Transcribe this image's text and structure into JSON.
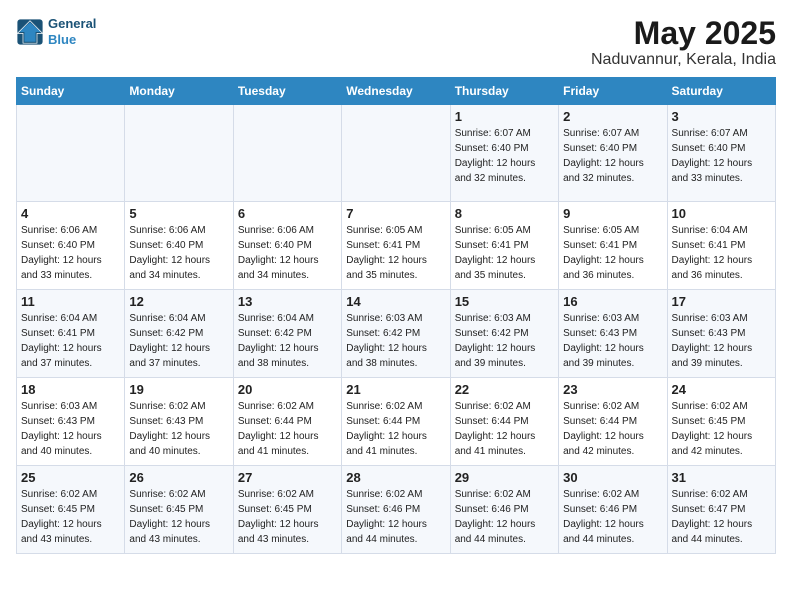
{
  "header": {
    "logo_line1": "General",
    "logo_line2": "Blue",
    "title": "May 2025",
    "subtitle": "Naduvannur, Kerala, India"
  },
  "days_of_week": [
    "Sunday",
    "Monday",
    "Tuesday",
    "Wednesday",
    "Thursday",
    "Friday",
    "Saturday"
  ],
  "weeks": [
    [
      {
        "day": "",
        "info": ""
      },
      {
        "day": "",
        "info": ""
      },
      {
        "day": "",
        "info": ""
      },
      {
        "day": "",
        "info": ""
      },
      {
        "day": "1",
        "sunrise": "6:07 AM",
        "sunset": "6:40 PM",
        "daylight": "12 hours and 32 minutes."
      },
      {
        "day": "2",
        "sunrise": "6:07 AM",
        "sunset": "6:40 PM",
        "daylight": "12 hours and 32 minutes."
      },
      {
        "day": "3",
        "sunrise": "6:07 AM",
        "sunset": "6:40 PM",
        "daylight": "12 hours and 33 minutes."
      }
    ],
    [
      {
        "day": "4",
        "sunrise": "6:06 AM",
        "sunset": "6:40 PM",
        "daylight": "12 hours and 33 minutes."
      },
      {
        "day": "5",
        "sunrise": "6:06 AM",
        "sunset": "6:40 PM",
        "daylight": "12 hours and 34 minutes."
      },
      {
        "day": "6",
        "sunrise": "6:06 AM",
        "sunset": "6:40 PM",
        "daylight": "12 hours and 34 minutes."
      },
      {
        "day": "7",
        "sunrise": "6:05 AM",
        "sunset": "6:41 PM",
        "daylight": "12 hours and 35 minutes."
      },
      {
        "day": "8",
        "sunrise": "6:05 AM",
        "sunset": "6:41 PM",
        "daylight": "12 hours and 35 minutes."
      },
      {
        "day": "9",
        "sunrise": "6:05 AM",
        "sunset": "6:41 PM",
        "daylight": "12 hours and 36 minutes."
      },
      {
        "day": "10",
        "sunrise": "6:04 AM",
        "sunset": "6:41 PM",
        "daylight": "12 hours and 36 minutes."
      }
    ],
    [
      {
        "day": "11",
        "sunrise": "6:04 AM",
        "sunset": "6:41 PM",
        "daylight": "12 hours and 37 minutes."
      },
      {
        "day": "12",
        "sunrise": "6:04 AM",
        "sunset": "6:42 PM",
        "daylight": "12 hours and 37 minutes."
      },
      {
        "day": "13",
        "sunrise": "6:04 AM",
        "sunset": "6:42 PM",
        "daylight": "12 hours and 38 minutes."
      },
      {
        "day": "14",
        "sunrise": "6:03 AM",
        "sunset": "6:42 PM",
        "daylight": "12 hours and 38 minutes."
      },
      {
        "day": "15",
        "sunrise": "6:03 AM",
        "sunset": "6:42 PM",
        "daylight": "12 hours and 39 minutes."
      },
      {
        "day": "16",
        "sunrise": "6:03 AM",
        "sunset": "6:43 PM",
        "daylight": "12 hours and 39 minutes."
      },
      {
        "day": "17",
        "sunrise": "6:03 AM",
        "sunset": "6:43 PM",
        "daylight": "12 hours and 39 minutes."
      }
    ],
    [
      {
        "day": "18",
        "sunrise": "6:03 AM",
        "sunset": "6:43 PM",
        "daylight": "12 hours and 40 minutes."
      },
      {
        "day": "19",
        "sunrise": "6:02 AM",
        "sunset": "6:43 PM",
        "daylight": "12 hours and 40 minutes."
      },
      {
        "day": "20",
        "sunrise": "6:02 AM",
        "sunset": "6:44 PM",
        "daylight": "12 hours and 41 minutes."
      },
      {
        "day": "21",
        "sunrise": "6:02 AM",
        "sunset": "6:44 PM",
        "daylight": "12 hours and 41 minutes."
      },
      {
        "day": "22",
        "sunrise": "6:02 AM",
        "sunset": "6:44 PM",
        "daylight": "12 hours and 41 minutes."
      },
      {
        "day": "23",
        "sunrise": "6:02 AM",
        "sunset": "6:44 PM",
        "daylight": "12 hours and 42 minutes."
      },
      {
        "day": "24",
        "sunrise": "6:02 AM",
        "sunset": "6:45 PM",
        "daylight": "12 hours and 42 minutes."
      }
    ],
    [
      {
        "day": "25",
        "sunrise": "6:02 AM",
        "sunset": "6:45 PM",
        "daylight": "12 hours and 43 minutes."
      },
      {
        "day": "26",
        "sunrise": "6:02 AM",
        "sunset": "6:45 PM",
        "daylight": "12 hours and 43 minutes."
      },
      {
        "day": "27",
        "sunrise": "6:02 AM",
        "sunset": "6:45 PM",
        "daylight": "12 hours and 43 minutes."
      },
      {
        "day": "28",
        "sunrise": "6:02 AM",
        "sunset": "6:46 PM",
        "daylight": "12 hours and 44 minutes."
      },
      {
        "day": "29",
        "sunrise": "6:02 AM",
        "sunset": "6:46 PM",
        "daylight": "12 hours and 44 minutes."
      },
      {
        "day": "30",
        "sunrise": "6:02 AM",
        "sunset": "6:46 PM",
        "daylight": "12 hours and 44 minutes."
      },
      {
        "day": "31",
        "sunrise": "6:02 AM",
        "sunset": "6:47 PM",
        "daylight": "12 hours and 44 minutes."
      }
    ]
  ]
}
